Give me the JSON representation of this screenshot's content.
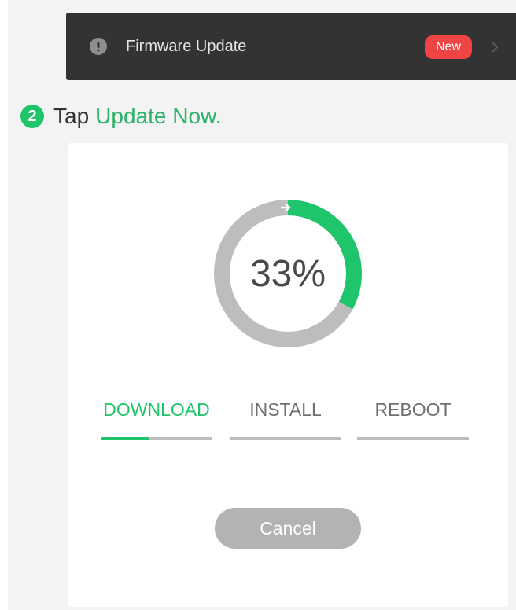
{
  "firmware_bar": {
    "label": "Firmware Update",
    "badge": "New",
    "icon": "info-icon",
    "chevron": "chevron-right-icon"
  },
  "step": {
    "number": "2",
    "text": "Tap",
    "highlight": "Update Now."
  },
  "progress": {
    "percent_label": "33%",
    "fraction": 0.33,
    "direction_icon": "arrow-right-icon"
  },
  "stages": [
    {
      "label": "DOWNLOAD",
      "active": true,
      "fill_fraction": 0.44
    },
    {
      "label": "INSTALL",
      "active": false,
      "fill_fraction": 0
    },
    {
      "label": "REBOOT",
      "active": false,
      "fill_fraction": 0
    }
  ],
  "cancel_label": "Cancel",
  "colors": {
    "accent": "#1ec56b",
    "track": "#bdbdbd",
    "bar_bg": "#333333",
    "badge": "#ef4444",
    "button": "#b3b3b3"
  }
}
